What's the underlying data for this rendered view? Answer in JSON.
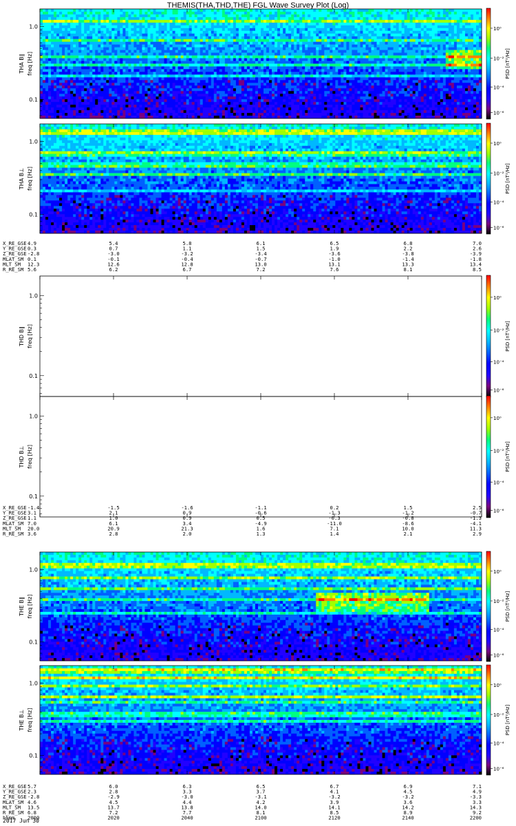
{
  "title": "THEMIS(THA,THD,THE) FGL Wave Survey Plot (Log)",
  "date_label": "2017 Jun 30",
  "colormap": [
    "#000000",
    "#7a0080",
    "#2200ff",
    "#0000ff",
    "#0060ff",
    "#00b8ff",
    "#00ffff",
    "#00ff80",
    "#a0ff00",
    "#ffff00",
    "#ff8000",
    "#ff0000"
  ],
  "chart_data": {
    "type": "heatmap",
    "panels": [
      {
        "id": "tha-bpar",
        "label": "THA B∥",
        "ylabel": "freq [Hz]",
        "yscale": "log",
        "yticks": [
          "1.0",
          "0.1"
        ],
        "colorbar_label": "PSD [nT²/Hz]",
        "colorbar_ticks": [
          "10⁰",
          "10⁻²",
          "10⁻⁴",
          "10⁻⁶"
        ],
        "empty": false,
        "features": [
          {
            "t_start": "21:50",
            "t_end": "22:00",
            "f_hz": 0.4,
            "level": "high"
          }
        ]
      },
      {
        "id": "tha-bperp",
        "label": "THA B⊥",
        "ylabel": "freq [Hz]",
        "yscale": "log",
        "yticks": [
          "1.0",
          "0.1"
        ],
        "colorbar_label": "PSD [nT²/Hz]",
        "colorbar_ticks": [
          "10⁰",
          "10⁻²",
          "10⁻⁴",
          "10⁻⁶"
        ],
        "empty": false,
        "features": []
      },
      {
        "id": "thd-bpar",
        "label": "THD B∥",
        "ylabel": "freq [Hz]",
        "yscale": "log",
        "yticks": [
          "1.0",
          "0.1"
        ],
        "colorbar_label": "PSD [nT²/Hz]",
        "colorbar_ticks": [
          "10⁰",
          "10⁻²",
          "10⁻⁴",
          "10⁻⁶"
        ],
        "empty": true,
        "features": []
      },
      {
        "id": "thd-bperp",
        "label": "THD B⊥",
        "ylabel": "freq [Hz]",
        "yscale": "log",
        "yticks": [
          "1.0",
          "0.1"
        ],
        "colorbar_label": "PSD [nT²/Hz]",
        "colorbar_ticks": [
          "10⁰",
          "10⁻²",
          "10⁻⁴",
          "10⁻⁶"
        ],
        "empty": true,
        "features": []
      },
      {
        "id": "the-bpar",
        "label": "THE B∥",
        "ylabel": "freq [Hz]",
        "yscale": "log",
        "yticks": [
          "1.0",
          "0.1"
        ],
        "colorbar_label": "PSD [nT²/Hz]",
        "colorbar_ticks": [
          "10⁰",
          "10⁻²",
          "10⁻⁴",
          "10⁻⁶"
        ],
        "empty": false,
        "features": [
          {
            "t_start": "21:15",
            "t_end": "21:45",
            "f_hz": 0.4,
            "level": "high"
          }
        ]
      },
      {
        "id": "the-bperp",
        "label": "THE B⊥",
        "ylabel": "freq [Hz]",
        "yscale": "log",
        "yticks": [
          "1.0",
          "0.1"
        ],
        "colorbar_label": "PSD [nT²/Hz]",
        "colorbar_ticks": [
          "10⁰",
          "10⁻²",
          "10⁻⁴",
          "10⁻⁶"
        ],
        "empty": false,
        "features": []
      }
    ],
    "ephemeris_blocks": [
      {
        "probe": "THA",
        "rows": [
          {
            "name": "X_RE_GSE",
            "values": [
              "4.9",
              "5.4",
              "5.8",
              "6.1",
              "6.5",
              "6.8",
              "7.0"
            ]
          },
          {
            "name": "Y_RE_GSE",
            "values": [
              "0.3",
              "0.7",
              "1.1",
              "1.5",
              "1.9",
              "2.2",
              "2.6"
            ]
          },
          {
            "name": "Z_RE_GSE",
            "values": [
              "-2.8",
              "-3.0",
              "-3.2",
              "-3.4",
              "-3.6",
              "-3.8",
              "-3.9"
            ]
          },
          {
            "name": "MLAT_SM",
            "values": [
              "0.1",
              "-0.1",
              "-0.4",
              "-0.7",
              "-1.0",
              "-1.4",
              "-1.8"
            ]
          },
          {
            "name": "MLT_SM",
            "values": [
              "12.3",
              "12.6",
              "12.8",
              "13.0",
              "13.1",
              "13.3",
              "13.4"
            ]
          },
          {
            "name": "R_RE_SM",
            "values": [
              "5.6",
              "6.2",
              "6.7",
              "7.2",
              "7.6",
              "8.1",
              "8.5"
            ]
          }
        ]
      },
      {
        "probe": "THD",
        "rows": [
          {
            "name": "X_RE_GSE",
            "values": [
              "-1.4",
              "-1.5",
              "-1.6",
              "-1.1",
              "0.2",
              "1.5",
              "2.5"
            ]
          },
          {
            "name": "Y_RE_GSE",
            "values": [
              "3.1",
              "2.1",
              "0.9",
              "-0.6",
              "-1.3",
              "-1.2",
              "-0.7"
            ]
          },
          {
            "name": "Z_RE_GSE",
            "values": [
              "1.1",
              "1.0",
              "0.9",
              "0.5",
              "-0.3",
              "-0.8",
              "-1.3"
            ]
          },
          {
            "name": "MLAT_SM",
            "values": [
              "7.0",
              "6.1",
              "3.4",
              "-4.9",
              "-11.0",
              "-8.6",
              "-4.1"
            ]
          },
          {
            "name": "MLT_SM",
            "values": [
              "20.0",
              "20.9",
              "21.3",
              "1.6",
              "7.1",
              "10.0",
              "11.3"
            ]
          },
          {
            "name": "R_RE_SM",
            "values": [
              "3.6",
              "2.8",
              "2.0",
              "1.3",
              "1.4",
              "2.1",
              "2.9"
            ]
          }
        ]
      },
      {
        "probe": "THE",
        "rows": [
          {
            "name": "X_RE_GSE",
            "values": [
              "5.7",
              "6.0",
              "6.3",
              "6.5",
              "6.7",
              "6.9",
              "7.1"
            ]
          },
          {
            "name": "Y_RE_GSE",
            "values": [
              "2.3",
              "2.8",
              "3.3",
              "3.7",
              "4.1",
              "4.5",
              "4.9"
            ]
          },
          {
            "name": "Z_RE_GSE",
            "values": [
              "-2.8",
              "-2.9",
              "-3.0",
              "-3.1",
              "-3.2",
              "-3.2",
              "-3.3"
            ]
          },
          {
            "name": "MLAT_SM",
            "values": [
              "4.6",
              "4.5",
              "4.4",
              "4.2",
              "3.9",
              "3.6",
              "3.3"
            ]
          },
          {
            "name": "MLT_SM",
            "values": [
              "13.5",
              "13.7",
              "13.8",
              "14.0",
              "14.1",
              "14.2",
              "14.3"
            ]
          },
          {
            "name": "R_RE_SM",
            "values": [
              "6.8",
              "7.2",
              "7.7",
              "8.1",
              "8.5",
              "8.9",
              "9.2"
            ]
          },
          {
            "name": "hhmm",
            "values": [
              "2000",
              "2020",
              "2040",
              "2100",
              "2120",
              "2140",
              "2200"
            ]
          }
        ]
      }
    ]
  }
}
